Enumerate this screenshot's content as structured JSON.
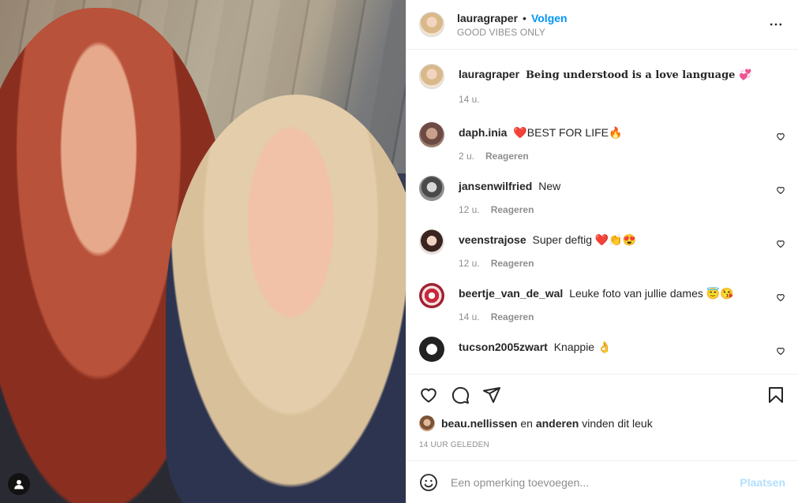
{
  "post": {
    "author": "lauragraper",
    "follow_label": "Volgen",
    "location": "GOOD VIBES ONLY",
    "separator": "•"
  },
  "caption": {
    "username": "lauragraper",
    "text": "Being understood is a love language 💞",
    "time": "14 u."
  },
  "comments": [
    {
      "username": "daph.inia",
      "text": "❤️BEST FOR LIFE🔥",
      "time": "2 u.",
      "reply_label": "Reageren"
    },
    {
      "username": "jansenwilfried",
      "text": "New",
      "time": "12 u.",
      "reply_label": "Reageren"
    },
    {
      "username": "veenstrajose",
      "text": "Super deftig ❤️👏😍",
      "time": "12 u.",
      "reply_label": "Reageren"
    },
    {
      "username": "beertje_van_de_wal",
      "text": "Leuke foto van jullie dames 😇😘",
      "time": "14 u.",
      "reply_label": "Reageren"
    },
    {
      "username": "tucson2005zwart",
      "text": "Knappie 👌",
      "time": "",
      "reply_label": ""
    }
  ],
  "likes": {
    "user": "beau.nellissen",
    "connector": "en",
    "others": "anderen",
    "suffix": "vinden dit leuk"
  },
  "timestamp": "14 UUR GELEDEN",
  "add_comment": {
    "placeholder": "Een opmerking toevoegen...",
    "post_label": "Plaatsen"
  },
  "colors": {
    "accent": "#0095f6",
    "post_disabled": "#b2dffc",
    "secondary_text": "#8e8e8e",
    "border": "#efefef"
  },
  "icons": [
    "user-tag-icon",
    "more-options-icon",
    "heart-icon",
    "comment-icon",
    "share-icon",
    "bookmark-icon",
    "emoji-icon"
  ]
}
